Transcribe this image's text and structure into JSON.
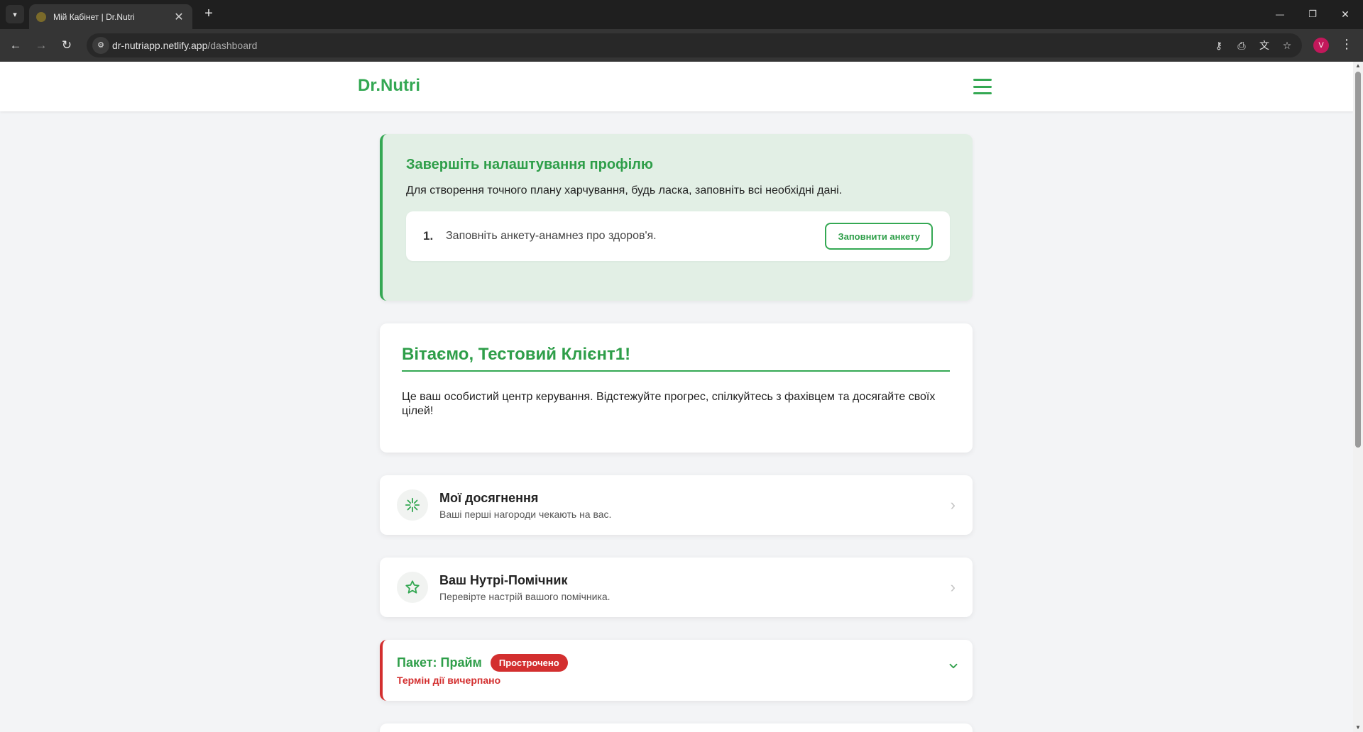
{
  "browser": {
    "tab_title": "Мій Кабінет | Dr.Nutri",
    "tab_close": "✕",
    "new_tab": "+",
    "url_host": "dr-nutriapp.netlify.app",
    "url_path": "/dashboard",
    "profile_initial": "V",
    "window_controls": {
      "minimize": "—",
      "restore": "❐",
      "close": "✕"
    }
  },
  "header": {
    "logo": "Dr.Nutri"
  },
  "setup": {
    "title": "Завершіть налаштування профілю",
    "description": "Для створення точного плану харчування, будь ласка, заповніть всі необхідні дані.",
    "steps": [
      {
        "number": "1.",
        "text": "Заповніть анкету-анамнез про здоров'я.",
        "button": "Заповнити анкету"
      }
    ]
  },
  "welcome": {
    "title": "Вітаємо, Тестовий Клієнт1!",
    "description": "Це ваш особистий центр керування. Відстежуйте прогрес, спілкуйтесь з фахівцем та досягайте своїх цілей!"
  },
  "achievements": {
    "icon": "sparkle-icon",
    "title": "Мої досягнення",
    "subtitle": "Ваші перші нагороди чекають на вас."
  },
  "assistant": {
    "icon": "star-icon",
    "title": "Ваш Нутрі-Помічник",
    "subtitle": "Перевірте настрій вашого помічника."
  },
  "package": {
    "title": "Пакет: Прайм",
    "badge": "Прострочено",
    "status": "Термін дії вичерпано"
  },
  "colors": {
    "brand_green": "#34a853",
    "danger_red": "#d32f2f",
    "setup_bg": "#e2efe5"
  }
}
